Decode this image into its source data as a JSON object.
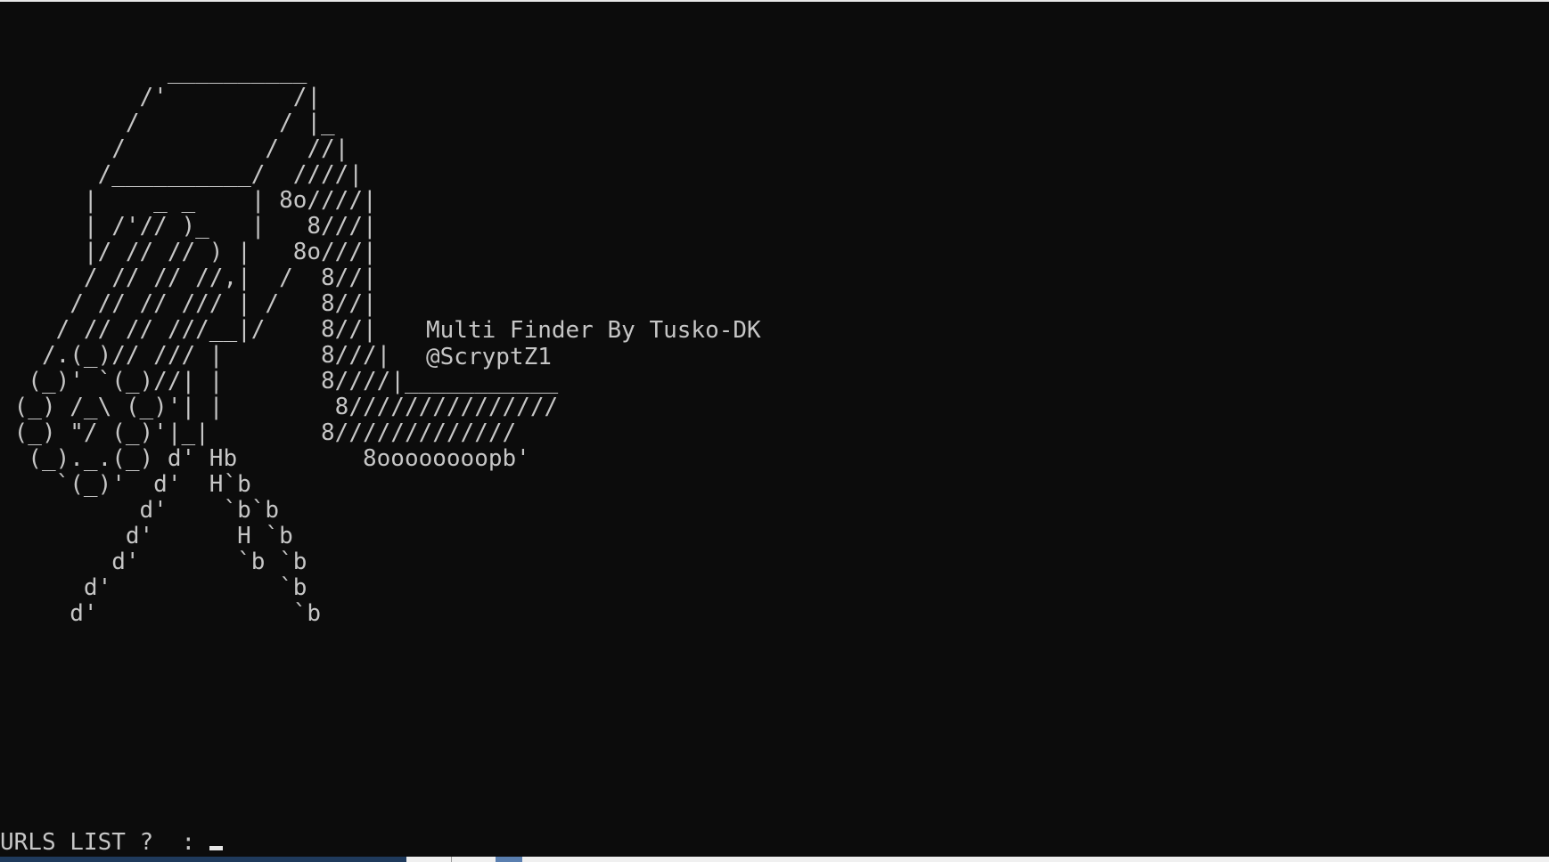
{
  "console": {
    "art_lines": [
      "            __________",
      "          /'         /|",
      "         /          / |_",
      "        /          /  //|",
      "       /__________/  ////|",
      "      |    _ _    | 8o////|",
      "      | /'// )_   |   8///|",
      "      |/ // // ) |   8o///|",
      "      / // // //,|  /  8//|",
      "     / // // /// | /   8//|",
      "    / // // ///__|/    8//|",
      "   /.(_)// /// |       8///|",
      "  (_)' `(_)//| |       8////|___________",
      " (_) /_\\ (_)'| |        8///////////////",
      " (_) \"/ (_)'|_|        8/////////////",
      "  (_)._.(_) d' Hb         8oooooooopb'",
      "    `(_)'  d'  H`b",
      "          d'    `b`b",
      "         d'      H `b",
      "        d'       `b `b",
      "      d'            `b",
      "     d'              `b"
    ],
    "title_text": "Multi Finder By Tusko-DK",
    "handle_text": "@ScryptZ1",
    "prompt_text": "URLS LIST ?  : "
  },
  "colors": {
    "background": "#0c0c0c",
    "text": "#c6c6c6"
  }
}
